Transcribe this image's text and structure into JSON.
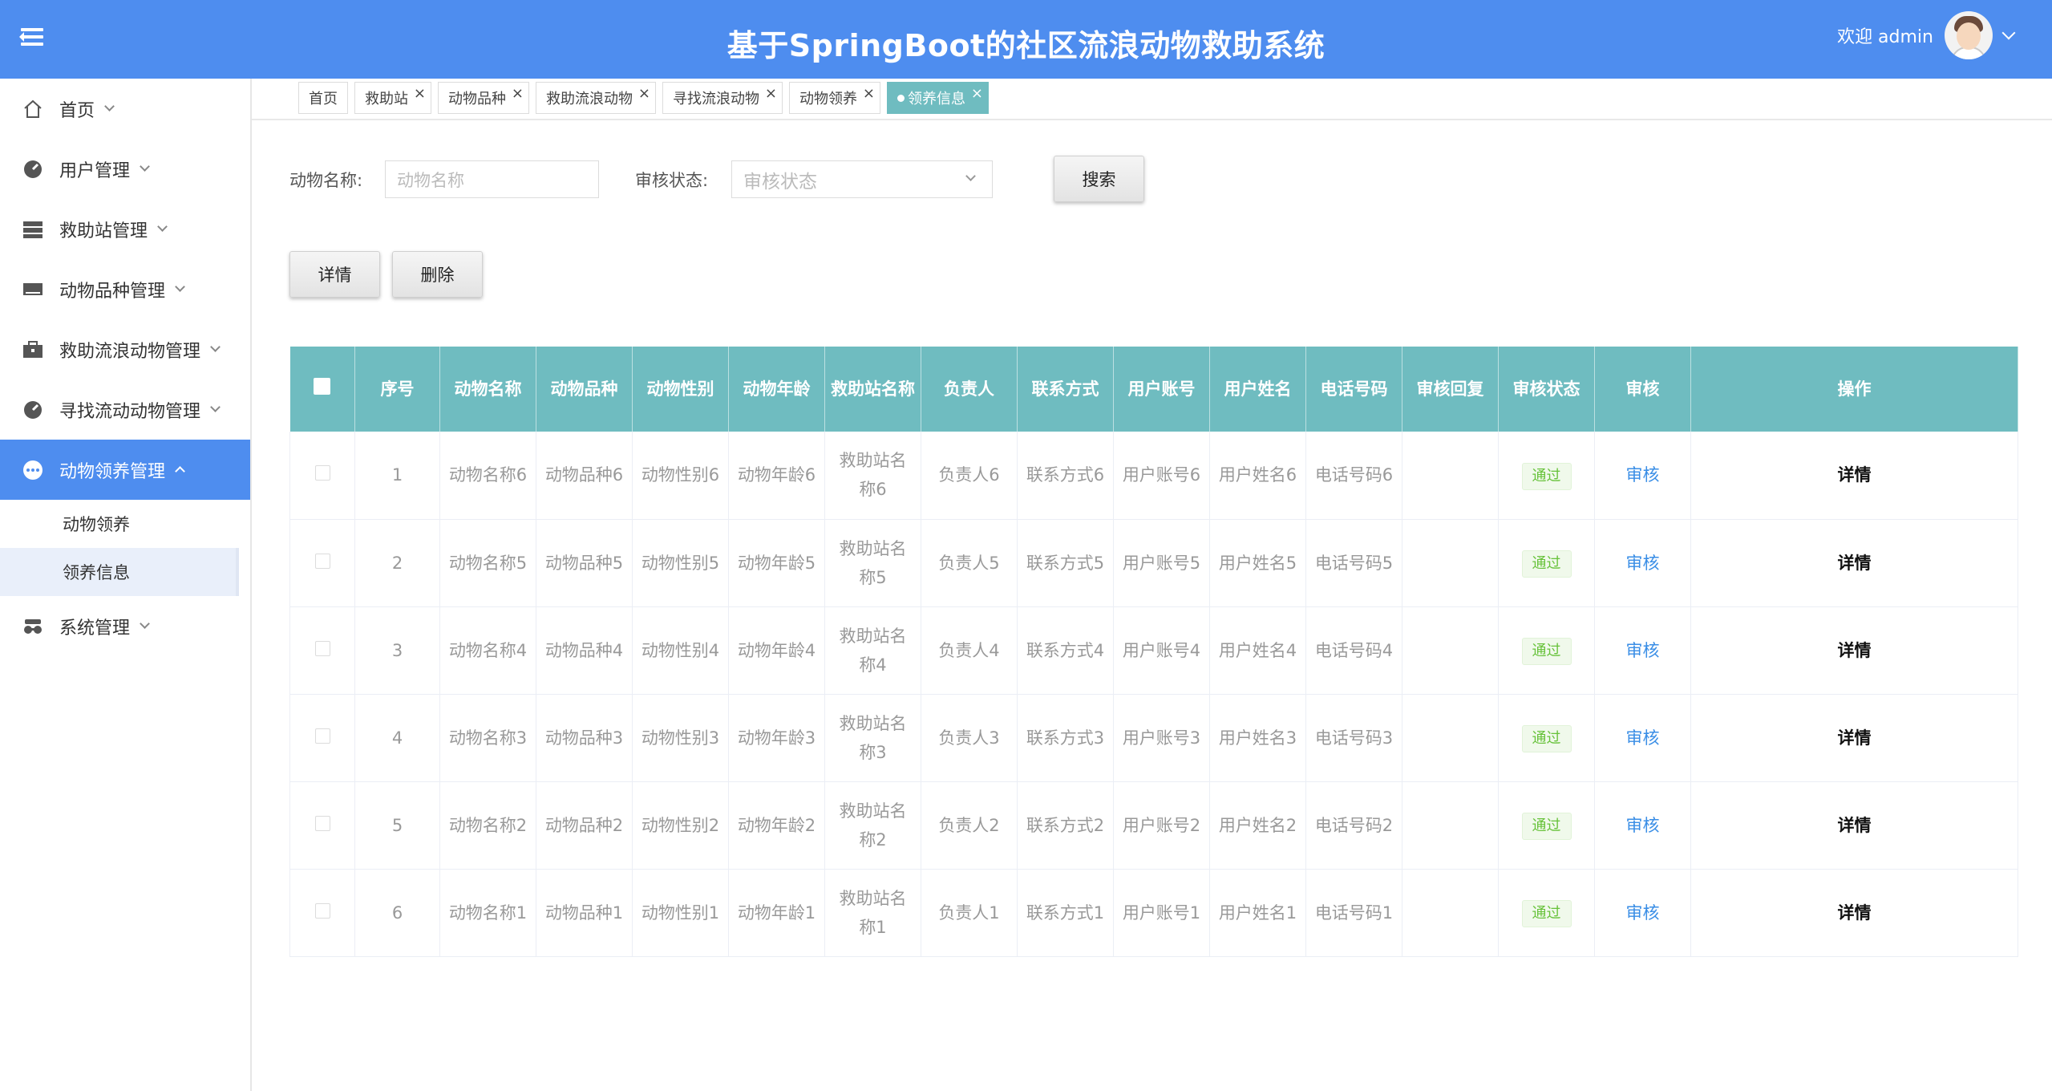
{
  "header": {
    "title": "基于SpringBoot的社区流浪动物救助系统",
    "welcome": "欢迎 admin"
  },
  "sidebar": {
    "items": [
      {
        "label": "首页",
        "icon": "home-icon"
      },
      {
        "label": "用户管理",
        "icon": "dashboard-icon"
      },
      {
        "label": "救助站管理",
        "icon": "storage-icon"
      },
      {
        "label": "动物品种管理",
        "icon": "keyboard-icon"
      },
      {
        "label": "救助流浪动物管理",
        "icon": "briefcase-icon"
      },
      {
        "label": "寻找流动动物管理",
        "icon": "dashboard-icon"
      },
      {
        "label": "动物领养管理",
        "icon": "more-icon"
      },
      {
        "label": "系统管理",
        "icon": "glasses-icon"
      }
    ],
    "submenu": [
      {
        "label": "动物领养"
      },
      {
        "label": "领养信息"
      }
    ]
  },
  "tabs": [
    {
      "label": "首页"
    },
    {
      "label": "救助站"
    },
    {
      "label": "动物品种"
    },
    {
      "label": "救助流浪动物"
    },
    {
      "label": "寻找流浪动物"
    },
    {
      "label": "动物领养"
    },
    {
      "label": "领养信息"
    }
  ],
  "search": {
    "name_label": "动物名称:",
    "name_placeholder": "动物名称",
    "status_label": "审核状态:",
    "status_placeholder": "审核状态",
    "search_button": "搜索"
  },
  "actions": {
    "detail_button": "详情",
    "delete_button": "删除"
  },
  "table": {
    "headers": [
      "序号",
      "动物名称",
      "动物品种",
      "动物性别",
      "动物年龄",
      "救助站名称",
      "负责人",
      "联系方式",
      "用户账号",
      "用户姓名",
      "电话号码",
      "审核回复",
      "审核状态",
      "审核",
      "操作"
    ],
    "rows": [
      {
        "no": "1",
        "name": "动物名称6",
        "breed": "动物品种6",
        "gender": "动物性别6",
        "age": "动物年龄6",
        "station": "救助站名称6",
        "owner": "负责人6",
        "contact": "联系方式6",
        "account": "用户账号6",
        "username": "用户姓名6",
        "phone": "电话号码6",
        "reply": "",
        "status": "通过",
        "review": "审核",
        "op": "详情"
      },
      {
        "no": "2",
        "name": "动物名称5",
        "breed": "动物品种5",
        "gender": "动物性别5",
        "age": "动物年龄5",
        "station": "救助站名称5",
        "owner": "负责人5",
        "contact": "联系方式5",
        "account": "用户账号5",
        "username": "用户姓名5",
        "phone": "电话号码5",
        "reply": "",
        "status": "通过",
        "review": "审核",
        "op": "详情"
      },
      {
        "no": "3",
        "name": "动物名称4",
        "breed": "动物品种4",
        "gender": "动物性别4",
        "age": "动物年龄4",
        "station": "救助站名称4",
        "owner": "负责人4",
        "contact": "联系方式4",
        "account": "用户账号4",
        "username": "用户姓名4",
        "phone": "电话号码4",
        "reply": "",
        "status": "通过",
        "review": "审核",
        "op": "详情"
      },
      {
        "no": "4",
        "name": "动物名称3",
        "breed": "动物品种3",
        "gender": "动物性别3",
        "age": "动物年龄3",
        "station": "救助站名称3",
        "owner": "负责人3",
        "contact": "联系方式3",
        "account": "用户账号3",
        "username": "用户姓名3",
        "phone": "电话号码3",
        "reply": "",
        "status": "通过",
        "review": "审核",
        "op": "详情"
      },
      {
        "no": "5",
        "name": "动物名称2",
        "breed": "动物品种2",
        "gender": "动物性别2",
        "age": "动物年龄2",
        "station": "救助站名称2",
        "owner": "负责人2",
        "contact": "联系方式2",
        "account": "用户账号2",
        "username": "用户姓名2",
        "phone": "电话号码2",
        "reply": "",
        "status": "通过",
        "review": "审核",
        "op": "详情"
      },
      {
        "no": "6",
        "name": "动物名称1",
        "breed": "动物品种1",
        "gender": "动物性别1",
        "age": "动物年龄1",
        "station": "救助站名称1",
        "owner": "负责人1",
        "contact": "联系方式1",
        "account": "用户账号1",
        "username": "用户姓名1",
        "phone": "电话号码1",
        "reply": "",
        "status": "通过",
        "review": "审核",
        "op": "详情"
      }
    ]
  },
  "colors": {
    "header_bg": "#4e8def",
    "table_header_bg": "#6fbcc0",
    "active_tab_bg": "#6fbcc0",
    "status_badge": "#67c23a",
    "link": "#3a8ee6"
  }
}
